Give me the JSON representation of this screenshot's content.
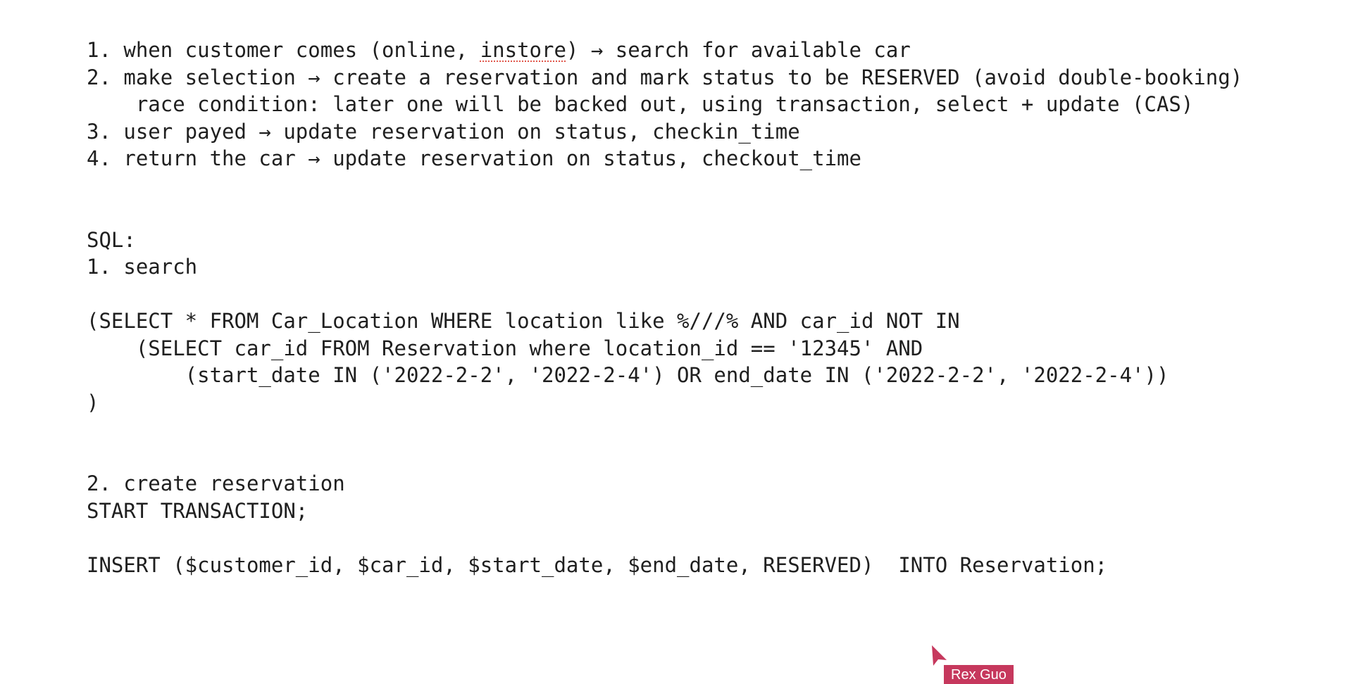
{
  "document": {
    "lines": [
      {
        "prefix": "1. when customer comes (online, ",
        "flagged": "instore",
        "suffix": ") → search for available car"
      },
      {
        "text": "2. make selection → create a reservation and mark status to be RESERVED (avoid double-booking)"
      },
      {
        "text": "    race condition: later one will be backed out, using transaction, select + update (CAS)"
      },
      {
        "text": "3. user payed → update reservation on status, checkin_time"
      },
      {
        "text": "4. return the car → update reservation on status, checkout_time"
      },
      {
        "text": ""
      },
      {
        "text": ""
      },
      {
        "text": "SQL:"
      },
      {
        "text": "1. search"
      },
      {
        "text": ""
      },
      {
        "text": "(SELECT * FROM Car_Location WHERE location like %///% AND car_id NOT IN"
      },
      {
        "text": "    (SELECT car_id FROM Reservation where location_id == '12345' AND"
      },
      {
        "text": "        (start_date IN ('2022-2-2', '2022-2-4') OR end_date IN ('2022-2-2', '2022-2-4'))"
      },
      {
        "text": ")"
      },
      {
        "text": ""
      },
      {
        "text": ""
      },
      {
        "text": "2. create reservation"
      },
      {
        "text": "START TRANSACTION;"
      },
      {
        "text": ""
      },
      {
        "text": "INSERT ($customer_id, $car_id, $start_date, $end_date, RESERVED)  INTO Reservation;"
      }
    ]
  },
  "collaborator": {
    "name": "Rex Guo",
    "color": "#c6385d",
    "icon": "cursor-pointer-icon"
  }
}
